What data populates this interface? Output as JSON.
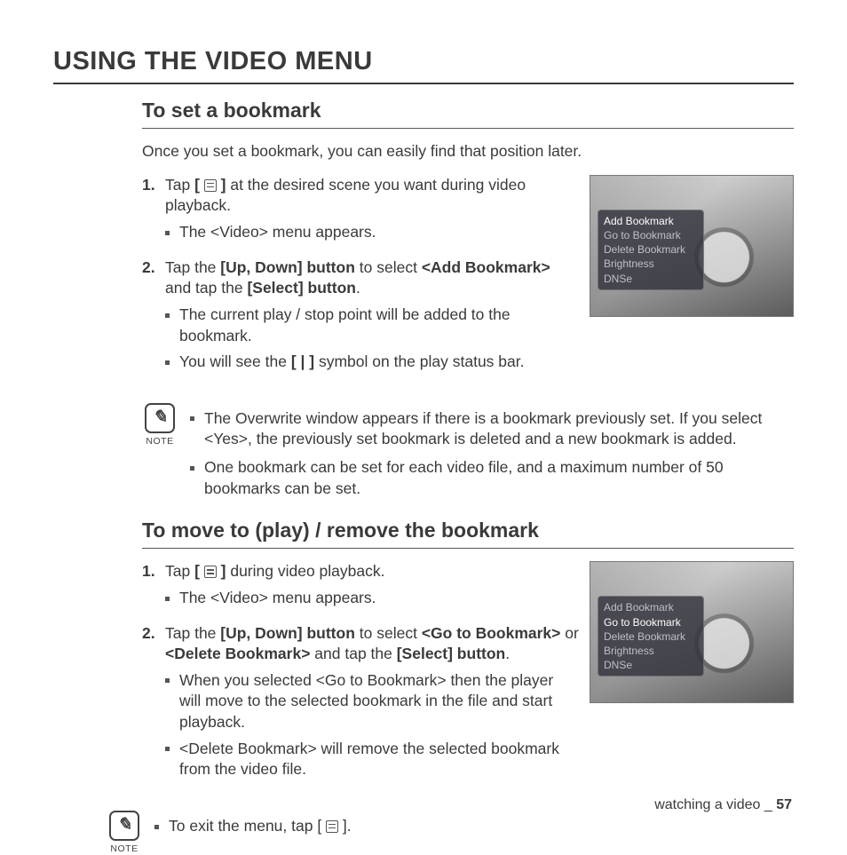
{
  "page_title": "USING THE VIDEO MENU",
  "section1": {
    "title": "To set a bookmark",
    "intro": "Once you set a bookmark, you can easily find that position later.",
    "step1_a": "Tap ",
    "step1_b": " at the desired scene you want during video playback.",
    "step1_sub1": "The <Video> menu appears.",
    "step2_a": "Tap the ",
    "step2_b": "[Up, Down] button",
    "step2_c": " to select ",
    "step2_d": "<Add Bookmark>",
    "step2_e": " and tap the ",
    "step2_f": "[Select] button",
    "step2_g": ".",
    "step2_sub1": "The current play / stop point will be added to the bookmark.",
    "step2_sub2_a": "You will see the ",
    "step2_sub2_b": "[ | ]",
    "step2_sub2_c": " symbol on the play status bar.",
    "note1_a": "The Overwrite window appears if there is a bookmark previously set. If you select <Yes>, the previously set bookmark is deleted and a new bookmark is added.",
    "note1_b": "One bookmark can be set for each video file, and a maximum number of 50 bookmarks can be set.",
    "menu": [
      "Add Bookmark",
      "Go to Bookmark",
      "Delete Bookmark",
      "Brightness",
      "DNSe"
    ],
    "selected": 0
  },
  "section2": {
    "title": "To move to (play) / remove the bookmark",
    "step1_a": "Tap ",
    "step1_b": " during video playback.",
    "step1_sub1": "The <Video> menu appears.",
    "step2_a": "Tap the ",
    "step2_b": "[Up, Down] button",
    "step2_c": " to select ",
    "step2_d": "<Go to Bookmark>",
    "step2_e": " or ",
    "step2_f": "<Delete Bookmark>",
    "step2_g": " and tap the ",
    "step2_h": "[Select] button",
    "step2_i": ".",
    "step2_sub1": "When you selected <Go to Bookmark> then the player will move to the selected bookmark in the file and start playback.",
    "step2_sub2": "<Delete Bookmark> will remove the selected bookmark from the video file.",
    "note1_a": "To exit the menu, tap [ ",
    "note1_b": " ].",
    "menu": [
      "Add Bookmark",
      "Go to Bookmark",
      "Delete Bookmark",
      "Brightness",
      "DNSe"
    ],
    "selected": 1
  },
  "note_label": "NOTE",
  "bracket_open": "[ ",
  "bracket_close": " ]",
  "footer_text": "watching a video _ ",
  "footer_page": "57"
}
